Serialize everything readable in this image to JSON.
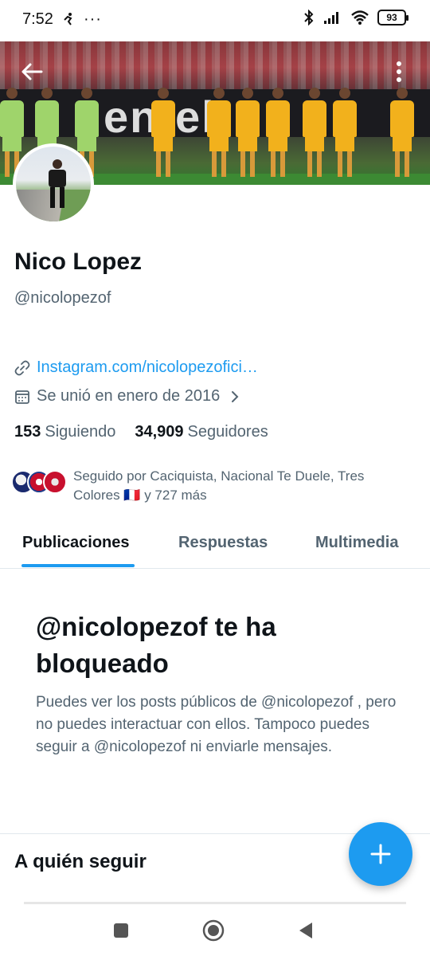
{
  "status_bar": {
    "time": "7:52",
    "battery": "93"
  },
  "banner": {
    "ad_text": "entel"
  },
  "profile": {
    "display_name": "Nico Lopez",
    "handle": "@nicolopezof",
    "link": "Instagram.com/nicolopezofici…",
    "joined": "Se unió en enero de 2016",
    "following_count": "153",
    "following_label": "Siguiendo",
    "followers_count": "34,909",
    "followers_label": "Seguidores",
    "followed_by": "Seguido por Caciquista, Nacional Te Duele, Tres Colores 🇫🇷 y 727 más"
  },
  "tabs": [
    {
      "label": "Publicaciones",
      "active": true
    },
    {
      "label": "Respuestas",
      "active": false
    },
    {
      "label": "Multimedia",
      "active": false
    }
  ],
  "blocked": {
    "title": "@nicolopezof te ha bloqueado",
    "description": "Puedes ver los posts públicos de @nicolopezof , pero no puedes interactuar con ellos. Tampoco puedes seguir a @nicolopezof ni enviarle mensajes."
  },
  "who_to_follow": {
    "title": "A quién seguir"
  },
  "colors": {
    "accent": "#1d9bf0",
    "text_primary": "#0f1419",
    "text_secondary": "#536471"
  },
  "icons": {
    "back": "back-arrow-icon",
    "more": "more-vertical-icon",
    "link": "link-icon",
    "calendar": "calendar-icon",
    "chevron": "chevron-right-icon",
    "compose": "plus-icon"
  }
}
